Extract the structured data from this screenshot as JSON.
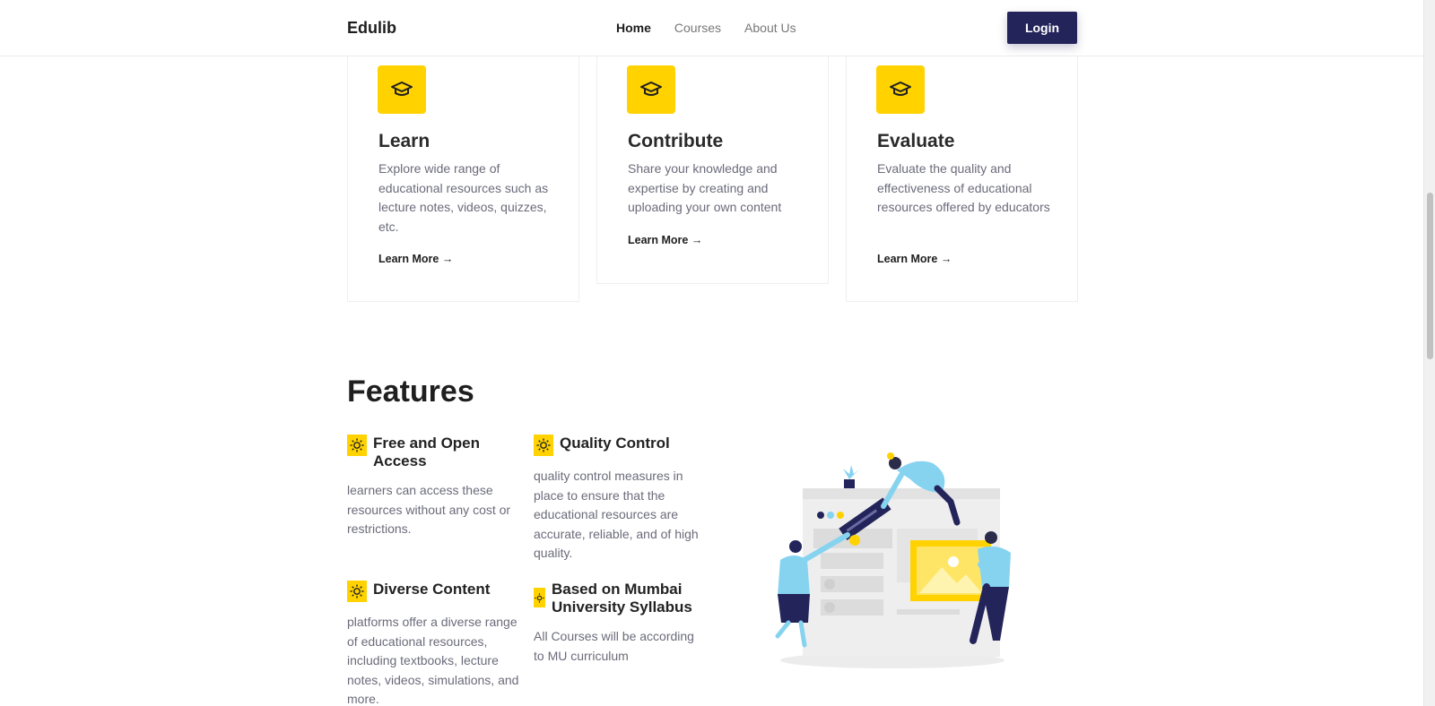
{
  "header": {
    "brand": "Edulib",
    "nav": [
      {
        "label": "Home",
        "active": true
      },
      {
        "label": "Courses",
        "active": false
      },
      {
        "label": "About Us",
        "active": false
      }
    ],
    "login_label": "Login"
  },
  "cards": [
    {
      "icon": "graduation-cap-icon",
      "title": "Learn",
      "text": "Explore wide range of educational resources such as lecture notes, videos, quizzes, etc.",
      "link": "Learn More →"
    },
    {
      "icon": "graduation-cap-icon",
      "title": "Contribute",
      "text": "Share your knowledge and expertise by creating and uploading your own content",
      "link": "Learn More →"
    },
    {
      "icon": "graduation-cap-icon",
      "title": "Evaluate",
      "text": "Evaluate the quality and effectiveness of educational resources offered by educators",
      "link": "Learn More →"
    }
  ],
  "features": {
    "title": "Features",
    "items": [
      {
        "icon": "sun-icon",
        "title": "Free and Open Access",
        "text": "learners can access these resources without any cost or restrictions."
      },
      {
        "icon": "sun-icon",
        "title": "Quality Control",
        "text": "quality control measures in place to ensure that the educational resources are accurate, reliable, and of high quality."
      },
      {
        "icon": "sun-icon",
        "title": "Diverse Content",
        "text": "platforms offer a diverse range of educational resources, including textbooks, lecture notes, videos, simulations, and more."
      },
      {
        "icon": "sun-icon",
        "title": "Based on Mumbai University Syllabus",
        "text": "All Courses will be according to MU curriculum"
      }
    ]
  },
  "colors": {
    "accent_yellow": "#ffd200",
    "navy": "#23245a",
    "light_blue": "#86d3f0"
  }
}
